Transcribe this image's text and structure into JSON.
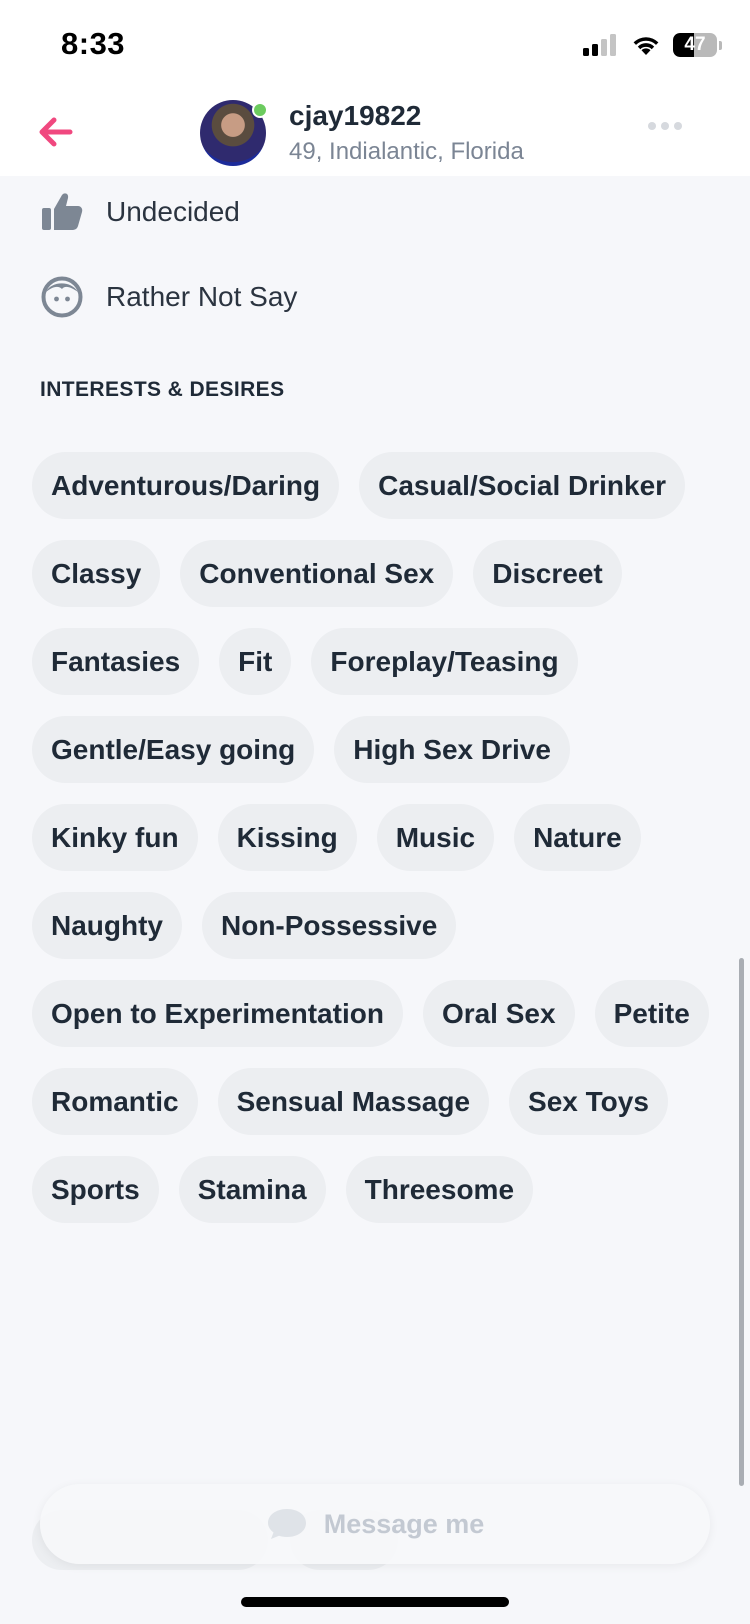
{
  "status_bar": {
    "time": "8:33",
    "battery_level": 47,
    "battery_label": "47",
    "icons": [
      "signal-icon",
      "wifi-icon",
      "battery-icon"
    ]
  },
  "header": {
    "back_icon": "back-arrow-icon",
    "username": "cjay19822",
    "subtitle": "49, Indialantic, Florida",
    "online": true,
    "more_icon": "more-options-icon",
    "accent_color": "#f0487f"
  },
  "details": [
    {
      "icon": "thumbs-up-icon",
      "text": "Undecided"
    },
    {
      "icon": "face-icon",
      "text": "Rather Not Say"
    }
  ],
  "interests": {
    "title": "INTERESTS & DESIRES",
    "tags": [
      "Adventurous/Daring",
      "Casual/Social Drinker",
      "Classy",
      "Conventional Sex",
      "Discreet",
      "Fantasies",
      "Fit",
      "Foreplay/Teasing",
      "Gentle/Easy going",
      "High Sex Drive",
      "Kinky fun",
      "Kissing",
      "Music",
      "Nature",
      "Naughty",
      "Non-Possessive",
      "Open to Experimentation",
      "Oral Sex",
      "Petite",
      "Romantic",
      "Sensual Massage",
      "Sex Toys",
      "Sports",
      "Stamina",
      "Threesome"
    ]
  },
  "message_button": {
    "label": "Message me",
    "icon": "chat-bubble-icon"
  }
}
